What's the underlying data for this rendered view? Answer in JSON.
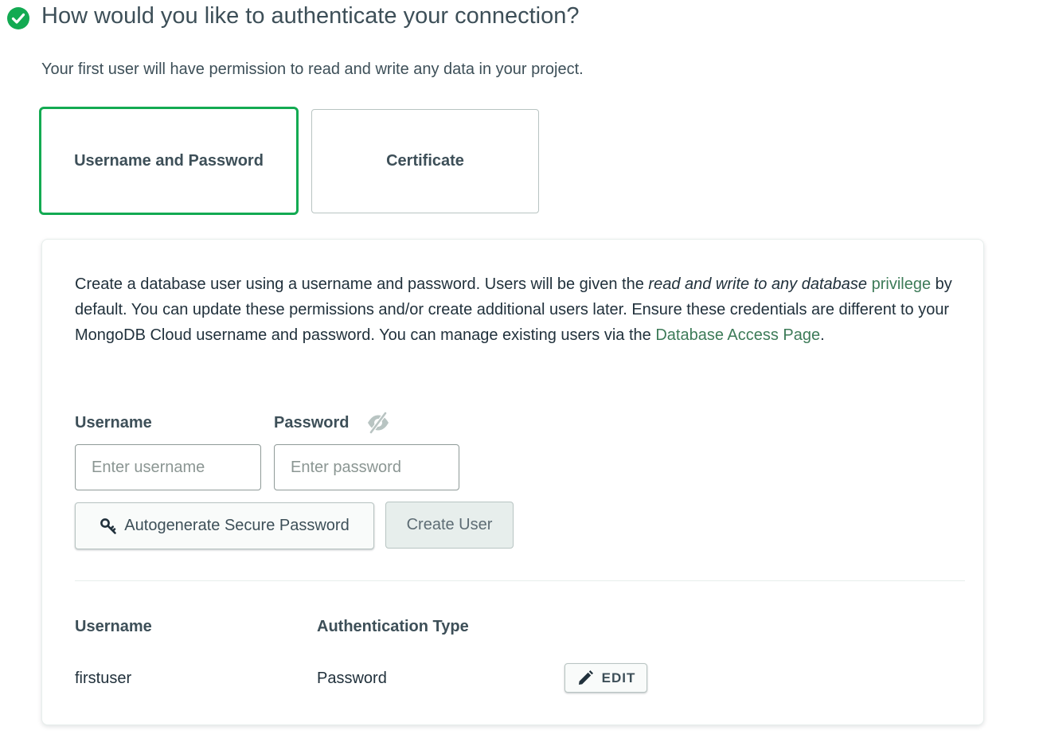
{
  "colors": {
    "success": "#13aa52",
    "link": "#3d7b58",
    "text": "#21313c"
  },
  "header": {
    "status_icon": "check-circle-icon",
    "title": "How would you like to authenticate your connection?",
    "subtitle": "Your first user will have permission to read and write any data in your project."
  },
  "auth_methods": [
    {
      "label": "Username and Password",
      "selected": true
    },
    {
      "label": "Certificate",
      "selected": false
    }
  ],
  "panel": {
    "description": {
      "part1": "Create a database user using a username and password. Users will be given the ",
      "emphasis": "read and write to any database",
      "space": " ",
      "link1": "privilege",
      "part2": " by default. You can update these permissions and/or create additional users later. Ensure these credentials are different to your MongoDB Cloud username and password. You can manage existing users via the ",
      "link2": "Database Access Page",
      "part3": "."
    },
    "username": {
      "label": "Username",
      "placeholder": "Enter username",
      "value": ""
    },
    "password": {
      "label": "Password",
      "placeholder": "Enter password",
      "value": "",
      "visibility_icon": "eye-slash-icon"
    },
    "autogenerate_button": {
      "label": "Autogenerate Secure Password",
      "icon": "key-icon"
    },
    "create_button": {
      "label": "Create User"
    },
    "users_table": {
      "columns": [
        "Username",
        "Authentication Type"
      ],
      "rows": [
        {
          "username": "firstuser",
          "auth_type": "Password",
          "action": "EDIT",
          "action_icon": "pencil-icon"
        }
      ]
    }
  }
}
